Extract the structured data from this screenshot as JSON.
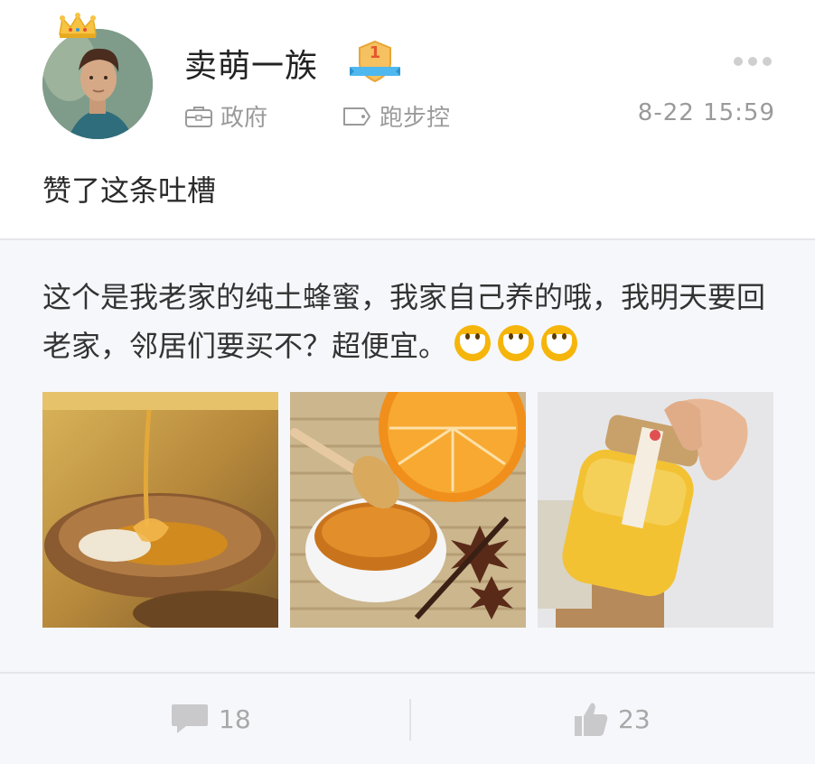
{
  "user": {
    "name": "卖萌一族",
    "level_badge": "1",
    "organization": "政府",
    "group": "跑步控",
    "time": "8-22  15:59"
  },
  "activity": {
    "text": "赞了这条吐槽"
  },
  "post": {
    "text": "这个是我老家的纯土蜂蜜，我家自己养的哦，我明天要回老家，邻居们要买不？超便宜。",
    "emoji_count": 3,
    "photos": [
      "honey-wooden-bowl",
      "honey-dipper-orange",
      "honey-jar"
    ]
  },
  "footer": {
    "comment_count": "18",
    "like_count": "23"
  },
  "colors": {
    "accent_orange": "#f5a623",
    "badge_blue": "#4fb8ef",
    "muted_text": "#9a9a9a",
    "emoji_yellow": "#f5b50a"
  }
}
